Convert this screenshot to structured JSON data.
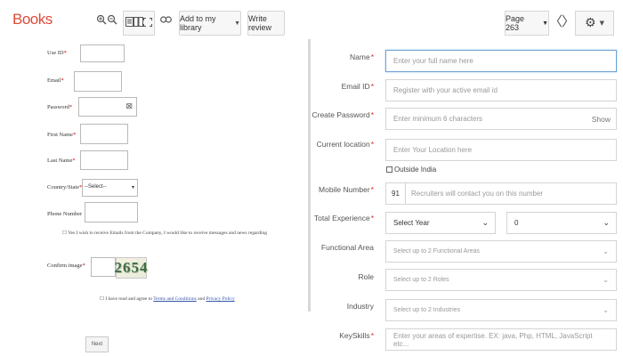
{
  "toolbar": {
    "brand": "Books",
    "zoom_in_icon": "zoom-in-icon",
    "zoom_out_icon": "zoom-out-icon",
    "view_icons": [
      "single-page-icon",
      "two-page-icon",
      "fullscreen-icon"
    ],
    "link_icon": "link-icon",
    "add_library_label": "Add to my library",
    "write_review_label": "Write review",
    "page_label": "Page 263",
    "prev_icon": "chevron-left-icon",
    "next_icon": "chevron-right-icon",
    "settings_icon": "gear-icon",
    "accent_color": "#dd4b39"
  },
  "left_form": {
    "fields": [
      {
        "label": "Use ID",
        "required": true
      },
      {
        "label": "Email",
        "required": true
      },
      {
        "label": "Password",
        "required": true
      },
      {
        "label": "First Name",
        "required": true
      },
      {
        "label": "Last Name",
        "required": true
      },
      {
        "label": "Country/State",
        "required": true
      },
      {
        "label": "Phone Number",
        "required": false
      }
    ],
    "country_select_value": "--Select--",
    "terms_text": "Yes I wish to receive Emails from the Company, I would like to receive messages and news regarding",
    "captcha_label": "Confirm image",
    "captcha_value": "2654",
    "agreement_prefix": "I have read and agree to",
    "agreement_link1": "Terms and Conditions",
    "agreement_mid": "and",
    "agreement_link2": "Privacy Policy",
    "submit_label": "Next"
  },
  "right_form": {
    "name_label": "Name",
    "name_placeholder": "Enter your full name here",
    "email_label": "Email ID",
    "email_placeholder": "Register with your active email id",
    "password_label": "Create Password",
    "password_placeholder": "Enter minimum 6 characters",
    "password_show": "Show",
    "location_label": "Current location",
    "location_placeholder": "Enter Your Location here",
    "outside_india": "Outside India",
    "mobile_label": "Mobile Number",
    "mobile_code": "91",
    "mobile_placeholder": "Recruiters will contact you on this number",
    "experience_label": "Total Experience",
    "experience_year": "Select Year",
    "experience_month": "0",
    "functional_label": "Functional Area",
    "functional_placeholder": "Select up to 2 Functional Areas",
    "role_label": "Role",
    "role_placeholder": "Select up to 2 Roles",
    "industry_label": "Industry",
    "industry_placeholder": "Select up to 2 Industries",
    "keyskills_label": "KeySkills",
    "keyskills_placeholder": "Enter your areas of expertise. EX: java, Php, HTML, JavaScript etc...",
    "required_color": "#e02424"
  }
}
